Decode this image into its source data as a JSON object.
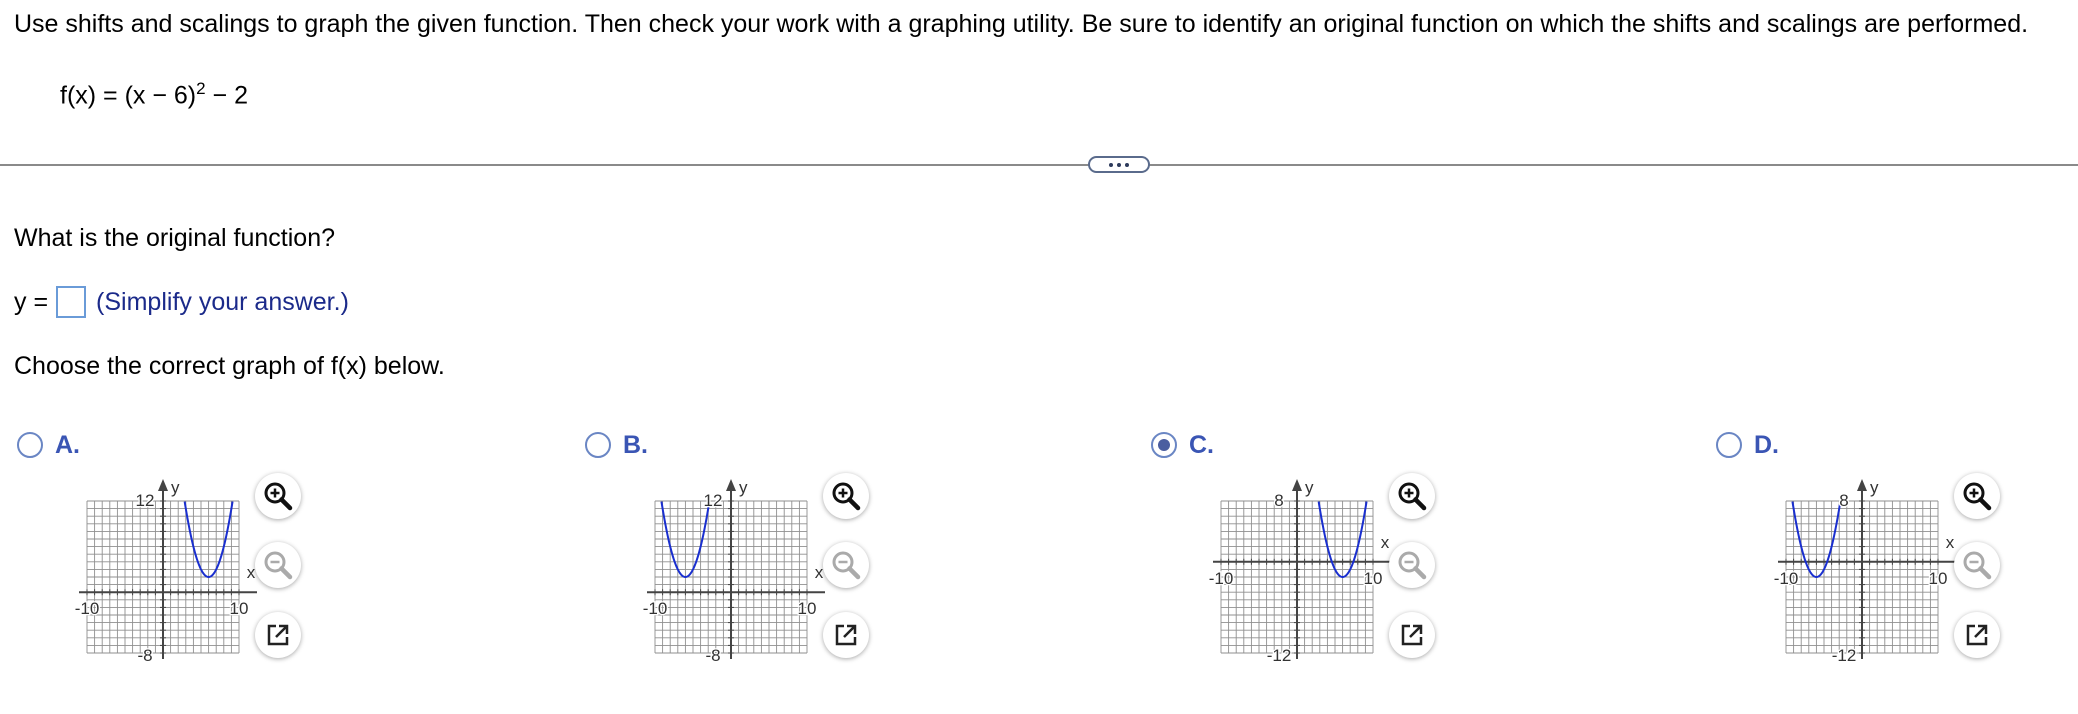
{
  "instructions": "Use shifts and scalings to graph the given function. Then check your work with a graphing utility. Be sure to identify an original function on which the shifts and scalings are performed.",
  "function": {
    "lhs": "f(x) = (x − 6)",
    "exponent": "2",
    "rhs": " − 2"
  },
  "question": "What is the original function?",
  "answer": {
    "prefix": "y =",
    "value": "",
    "hint": "(Simplify your answer.)"
  },
  "choose_prompt": "Choose the correct graph of f(x) below.",
  "options": [
    {
      "letter": "A.",
      "selected": false,
      "axis_x": "x",
      "axis_y": "y",
      "x_min_label": "-10",
      "x_max_label": "10",
      "y_max_label": "12",
      "y_min_label": "-8"
    },
    {
      "letter": "B.",
      "selected": false,
      "axis_x": "x",
      "axis_y": "y",
      "x_min_label": "-10",
      "x_max_label": "10",
      "y_max_label": "12",
      "y_min_label": "-8"
    },
    {
      "letter": "C.",
      "selected": true,
      "axis_x": "x",
      "axis_y": "y",
      "x_min_label": "-10",
      "x_max_label": "10",
      "y_max_label": "8",
      "y_min_label": "-12"
    },
    {
      "letter": "D.",
      "selected": false,
      "axis_x": "x",
      "axis_y": "y",
      "x_min_label": "-10",
      "x_max_label": "10",
      "y_max_label": "8",
      "y_min_label": "-12"
    }
  ],
  "chart_data": [
    {
      "type": "line",
      "series": [
        {
          "vertex": [
            6,
            2
          ],
          "a": 1
        }
      ],
      "xlim": [
        -10,
        10
      ],
      "ylim": [
        -8,
        12
      ],
      "grid": true
    },
    {
      "type": "line",
      "series": [
        {
          "vertex": [
            -6,
            2
          ],
          "a": 1
        }
      ],
      "xlim": [
        -10,
        10
      ],
      "ylim": [
        -8,
        12
      ],
      "grid": true
    },
    {
      "type": "line",
      "series": [
        {
          "vertex": [
            6,
            -2
          ],
          "a": 1
        }
      ],
      "xlim": [
        -10,
        10
      ],
      "ylim": [
        -12,
        8
      ],
      "grid": true
    },
    {
      "type": "line",
      "series": [
        {
          "vertex": [
            -6,
            -2
          ],
          "a": 1
        }
      ],
      "xlim": [
        -10,
        10
      ],
      "ylim": [
        -12,
        8
      ],
      "grid": true
    }
  ],
  "colors": {
    "curve": "#1a2fcf",
    "link": "#3a55b4",
    "hint": "#1b2a8a"
  },
  "icons": {
    "zoom_in": "zoom-in-icon",
    "zoom_out": "zoom-out-icon",
    "popout": "popout-icon"
  }
}
